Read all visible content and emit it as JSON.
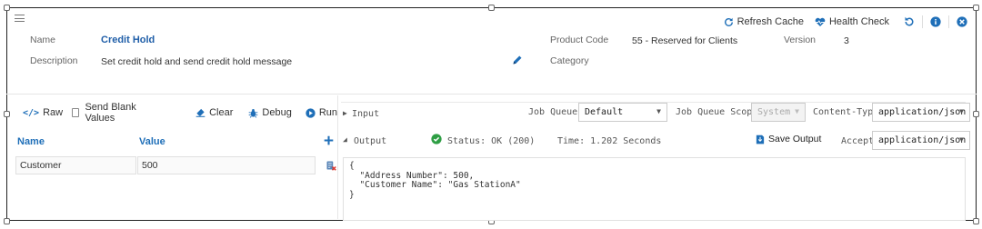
{
  "toolbar": {
    "refresh_cache": "Refresh Cache",
    "health_check": "Health Check"
  },
  "info": {
    "name_label": "Name",
    "name_value": "Credit Hold",
    "description_label": "Description",
    "description_value": "Set credit hold and send credit hold message",
    "product_code_label": "Product Code",
    "product_code_value": "55 - Reserved for Clients",
    "version_label": "Version",
    "version_value": "3",
    "category_label": "Category",
    "category_value": ""
  },
  "left": {
    "raw": "Raw",
    "send_blank": "Send Blank Values",
    "clear": "Clear",
    "debug": "Debug",
    "run": "Run",
    "col_name": "Name",
    "col_value": "Value",
    "rows": [
      {
        "name": "Customer",
        "value": "500"
      }
    ]
  },
  "right": {
    "input_label": "Input",
    "job_queue_label": "Job Queue",
    "job_queue_value": "Default",
    "job_queue_scope_label": "Job Queue Scope",
    "job_queue_scope_value": "System",
    "content_type_label": "Content-Type",
    "content_type_value": "application/json",
    "output_label": "Output",
    "status": "Status: OK (200)",
    "time": "Time: 1.202 Seconds",
    "save_output": "Save Output",
    "accept_label": "Accept",
    "accept_value": "application/json",
    "output_json": "{\n  \"Address Number\": 500,\n  \"Customer Name\": \"Gas StationA\"\n}"
  },
  "colors": {
    "accent": "#1f6fb8",
    "success": "#2e9e44",
    "danger": "#d9342b"
  }
}
